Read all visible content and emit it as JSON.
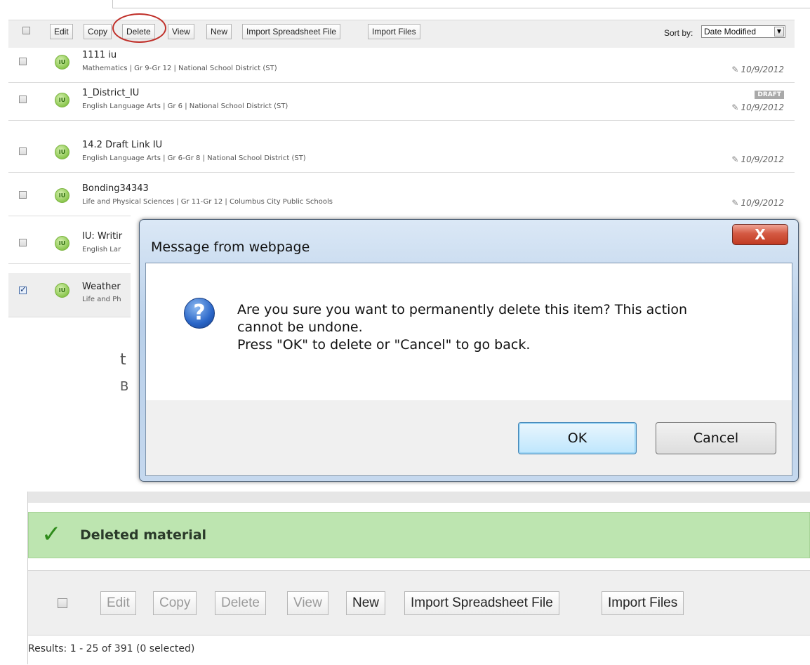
{
  "top_toolbar": {
    "buttons": [
      "Edit",
      "Copy",
      "Delete",
      "View",
      "New",
      "Import Spreadsheet File",
      "Import Files"
    ],
    "sort_label": "Sort by:",
    "sort_value": "Date Modified"
  },
  "items": [
    {
      "title": "1111 iu",
      "meta": "Mathematics  |  Gr 9-Gr 12  |  National School District (ST)",
      "date": "10/9/2012",
      "checked": false,
      "draft": ""
    },
    {
      "title": "1_District_IU",
      "meta": "English Language Arts  |  Gr 6  |  National School District (ST)",
      "date": "10/9/2012",
      "checked": false,
      "draft": "DRAFT"
    },
    {
      "title": "14.2 Draft Link IU",
      "meta": "English Language Arts  |  Gr 6-Gr 8  |  National School District (ST)",
      "date": "10/9/2012",
      "checked": false,
      "draft": ""
    },
    {
      "title": "Bonding34343",
      "meta": "Life and Physical Sciences  |  Gr 11-Gr 12  |  Columbus City Public Schools",
      "date": "10/9/2012",
      "checked": false,
      "draft": ""
    },
    {
      "title": "IU: Writir",
      "meta": "English Lar",
      "date": "",
      "checked": false,
      "draft": ""
    },
    {
      "title": "Weather",
      "meta": "Life and Ph",
      "date": "",
      "checked": true,
      "draft": ""
    }
  ],
  "icon_label": "IU",
  "dialog": {
    "title": "Message from webpage",
    "close_label": "X",
    "icon": "question-icon",
    "message_line1": "Are you sure you want to permanently delete this item? This action",
    "message_line2": "cannot be undone.",
    "message_line3": "Press \"OK\" to delete or \"Cancel\" to go back.",
    "ok_label": "OK",
    "cancel_label": "Cancel"
  },
  "background_fragments": {
    "frag1": "t",
    "frag2": "B"
  },
  "success": {
    "icon": "checkmark-icon",
    "message": "Deleted material"
  },
  "bottom_toolbar": {
    "buttons": [
      "Edit",
      "Copy",
      "Delete",
      "View",
      "New",
      "Import Spreadsheet File",
      "Import Files"
    ]
  },
  "results_text": "Results: 1 - 25 of 391 (0 selected)",
  "colors": {
    "success_bg": "#bde5b0",
    "success_check": "#2e8b1a",
    "highlight_circle": "#c0302a"
  }
}
